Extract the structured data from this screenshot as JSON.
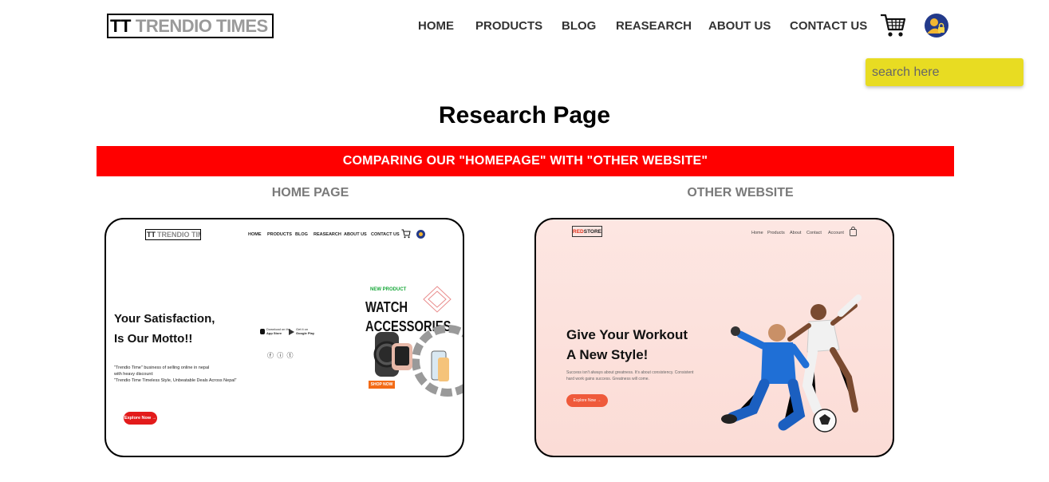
{
  "header": {
    "logo_mark": "TT",
    "logo_brand": "TRENDIO TIMES",
    "nav": [
      "HOME",
      "PRODUCTS",
      "BLOG",
      "REASEARCH",
      "ABOUT US",
      "CONTACT US"
    ],
    "cart_icon": "shopping-cart-icon",
    "avatar_icon": "user-lock-icon"
  },
  "search": {
    "placeholder": "search here",
    "background": "#e8dc22"
  },
  "page": {
    "title": "Research Page",
    "banner": "COMPARING OUR \"HOMEPAGE\" WITH \"OTHER WEBSITE\"",
    "banner_color": "#ff0000",
    "left_label": "HOME PAGE",
    "right_label": "OTHER WEBSITE"
  },
  "home_preview": {
    "logo_mark": "TT",
    "logo_brand": "TRENDIO TIMES",
    "nav": [
      "HOME",
      "PRODUCTS",
      "BLOG",
      "REASEARCH",
      "ABOUT US",
      "CONTACT US"
    ],
    "hero_line1": "Your Satisfaction,",
    "hero_line2": "Is Our Motto!!",
    "desc_line1": "\"Trendio Time\" business of selling online in nepal",
    "desc_line2": "with heavy discount:",
    "desc_line3": "\"Trendio Time Timeless Style, Unbeatable Deals Across Nepal\"",
    "explore": "Explore Now →",
    "app_store_top": "Download on the",
    "app_store": "App Store",
    "play_store_top": "Get it on",
    "play_store": "Google Play",
    "social": "ⓕ ⓘ ⓣ",
    "new_product": "NEW PRODUCT",
    "watch_line1": "WATCH",
    "watch_line2": "ACCESSORIES",
    "shop_now": "SHOP NOW"
  },
  "other_preview": {
    "logo_red": "RED",
    "logo_rest": "STORE",
    "nav": [
      "Home",
      "Products",
      "About",
      "Contact",
      "Account"
    ],
    "hero_line1": "Give Your Workout",
    "hero_line2": "A New Style!",
    "desc_line1": "Success isn't always about greatness. It's about consistency. Consistent",
    "desc_line2": "hard work gains success. Greatness will come.",
    "explore": "Explore Now →"
  }
}
